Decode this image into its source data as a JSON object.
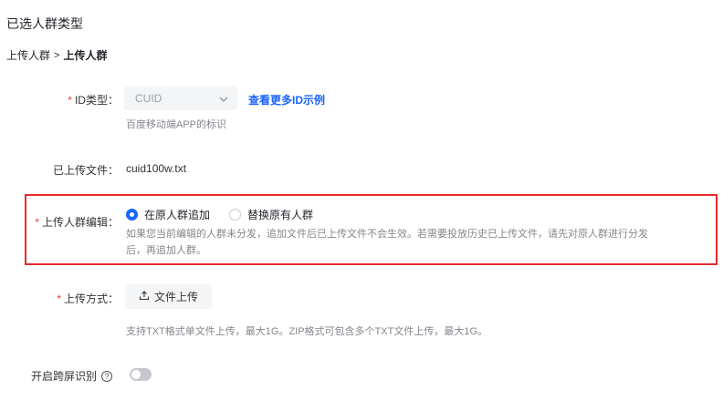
{
  "section": {
    "title": "已选人群类型"
  },
  "breadcrumb": {
    "parent": "上传人群",
    "separator": ">",
    "current": "上传人群"
  },
  "id_type": {
    "required_mark": "*",
    "label": "ID类型",
    "colon": "：",
    "selected": "CUID",
    "more_link": "查看更多ID示例",
    "hint": "百度移动端APP的标识"
  },
  "uploaded_file": {
    "label": "已上传文件：",
    "value": "cuid100w.txt"
  },
  "edit_mode": {
    "required_mark": "*",
    "label": "上传人群编辑：",
    "options": [
      {
        "label": "在原人群追加",
        "checked": true
      },
      {
        "label": "替换原有人群",
        "checked": false
      }
    ],
    "hint_line1": "如果您当前编辑的人群未分发，追加文件后已上传文件不会生效。若需要投放历史已上传文件，请先对原人群进行分发",
    "hint_line2": "后，再追加人群。"
  },
  "upload_method": {
    "required_mark": "*",
    "label": "上传方式：",
    "button": "文件上传",
    "hint": "支持TXT格式单文件上传，最大1G。ZIP格式可包含多个TXT文件上传，最大1G。"
  },
  "cross_screen": {
    "label": "开启跨屏识别",
    "help": "?",
    "enabled": false
  },
  "colors": {
    "accent": "#1a66ff",
    "required": "#e53935",
    "highlight_border": "#e52b2b"
  }
}
